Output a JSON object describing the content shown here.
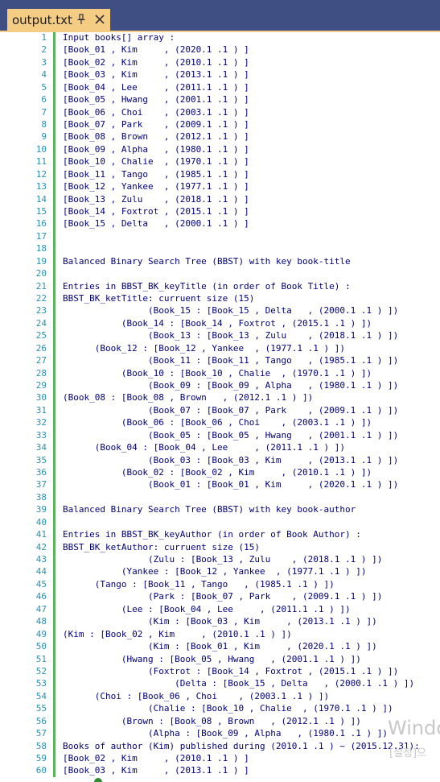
{
  "tab": {
    "title": "output.txt",
    "pin_icon": "pin-icon",
    "close_icon": "close-icon"
  },
  "editor": {
    "lines": [
      {
        "num": "1",
        "text": "Input books[] array :"
      },
      {
        "num": "2",
        "text": "[Book_01 , Kim     , (2020.1 .1 ) ]"
      },
      {
        "num": "3",
        "text": "[Book_02 , Kim     , (2010.1 .1 ) ]"
      },
      {
        "num": "4",
        "text": "[Book_03 , Kim     , (2013.1 .1 ) ]"
      },
      {
        "num": "5",
        "text": "[Book_04 , Lee     , (2011.1 .1 ) ]"
      },
      {
        "num": "6",
        "text": "[Book_05 , Hwang   , (2001.1 .1 ) ]"
      },
      {
        "num": "7",
        "text": "[Book_06 , Choi    , (2003.1 .1 ) ]"
      },
      {
        "num": "8",
        "text": "[Book_07 , Park    , (2009.1 .1 ) ]"
      },
      {
        "num": "9",
        "text": "[Book_08 , Brown   , (2012.1 .1 ) ]"
      },
      {
        "num": "10",
        "text": "[Book_09 , Alpha   , (1980.1 .1 ) ]"
      },
      {
        "num": "11",
        "text": "[Book_10 , Chalie  , (1970.1 .1 ) ]"
      },
      {
        "num": "12",
        "text": "[Book_11 , Tango   , (1985.1 .1 ) ]"
      },
      {
        "num": "13",
        "text": "[Book_12 , Yankee  , (1977.1 .1 ) ]"
      },
      {
        "num": "14",
        "text": "[Book_13 , Zulu    , (2018.1 .1 ) ]"
      },
      {
        "num": "15",
        "text": "[Book_14 , Foxtrot , (2015.1 .1 ) ]"
      },
      {
        "num": "16",
        "text": "[Book_15 , Delta   , (2000.1 .1 ) ]"
      },
      {
        "num": "17",
        "text": ""
      },
      {
        "num": "18",
        "text": ""
      },
      {
        "num": "19",
        "text": "Balanced Binary Search Tree (BBST) with key book-title"
      },
      {
        "num": "20",
        "text": ""
      },
      {
        "num": "21",
        "text": "Entries in BBST_BK_keyTitle (in order of Book Title) :"
      },
      {
        "num": "22",
        "text": "BBST_BK_ketTitle: curruent size (15)"
      },
      {
        "num": "23",
        "text": "                (Book_15 : [Book_15 , Delta   , (2000.1 .1 ) ])"
      },
      {
        "num": "24",
        "text": "           (Book_14 : [Book_14 , Foxtrot , (2015.1 .1 ) ])"
      },
      {
        "num": "25",
        "text": "                (Book_13 : [Book_13 , Zulu    , (2018.1 .1 ) ])"
      },
      {
        "num": "26",
        "text": "      (Book_12 : [Book_12 , Yankee  , (1977.1 .1 ) ])"
      },
      {
        "num": "27",
        "text": "                (Book_11 : [Book_11 , Tango   , (1985.1 .1 ) ])"
      },
      {
        "num": "28",
        "text": "           (Book_10 : [Book_10 , Chalie  , (1970.1 .1 ) ])"
      },
      {
        "num": "29",
        "text": "                (Book_09 : [Book_09 , Alpha   , (1980.1 .1 ) ])"
      },
      {
        "num": "30",
        "text": "(Book_08 : [Book_08 , Brown   , (2012.1 .1 ) ])"
      },
      {
        "num": "31",
        "text": "                (Book_07 : [Book_07 , Park    , (2009.1 .1 ) ])"
      },
      {
        "num": "32",
        "text": "           (Book_06 : [Book_06 , Choi    , (2003.1 .1 ) ])"
      },
      {
        "num": "33",
        "text": "                (Book_05 : [Book_05 , Hwang   , (2001.1 .1 ) ])"
      },
      {
        "num": "34",
        "text": "      (Book_04 : [Book_04 , Lee     , (2011.1 .1 ) ])"
      },
      {
        "num": "35",
        "text": "                (Book_03 : [Book_03 , Kim     , (2013.1 .1 ) ])"
      },
      {
        "num": "36",
        "text": "           (Book_02 : [Book_02 , Kim     , (2010.1 .1 ) ])"
      },
      {
        "num": "37",
        "text": "                (Book_01 : [Book_01 , Kim     , (2020.1 .1 ) ])"
      },
      {
        "num": "38",
        "text": ""
      },
      {
        "num": "39",
        "text": "Balanced Binary Search Tree (BBST) with key book-author"
      },
      {
        "num": "40",
        "text": ""
      },
      {
        "num": "41",
        "text": "Entries in BBST_BK_keyAuthor (in order of Book Author) :"
      },
      {
        "num": "42",
        "text": "BBST_BK_ketAuthor: curruent size (15)"
      },
      {
        "num": "43",
        "text": "                (Zulu : [Book_13 , Zulu    , (2018.1 .1 ) ])"
      },
      {
        "num": "44",
        "text": "           (Yankee : [Book_12 , Yankee  , (1977.1 .1 ) ])"
      },
      {
        "num": "45",
        "text": "      (Tango : [Book_11 , Tango   , (1985.1 .1 ) ])"
      },
      {
        "num": "46",
        "text": "                (Park : [Book_07 , Park    , (2009.1 .1 ) ])"
      },
      {
        "num": "47",
        "text": "           (Lee : [Book_04 , Lee     , (2011.1 .1 ) ])"
      },
      {
        "num": "48",
        "text": "                (Kim : [Book_03 , Kim     , (2013.1 .1 ) ])"
      },
      {
        "num": "49",
        "text": "(Kim : [Book_02 , Kim     , (2010.1 .1 ) ])"
      },
      {
        "num": "50",
        "text": "                (Kim : [Book_01 , Kim     , (2020.1 .1 ) ])"
      },
      {
        "num": "51",
        "text": "           (Hwang : [Book_05 , Hwang   , (2001.1 .1 ) ])"
      },
      {
        "num": "52",
        "text": "                (Foxtrot : [Book_14 , Foxtrot , (2015.1 .1 ) ])"
      },
      {
        "num": "53",
        "text": "                     (Delta : [Book_15 , Delta   , (2000.1 .1 ) ])"
      },
      {
        "num": "54",
        "text": "      (Choi : [Book_06 , Choi    , (2003.1 .1 ) ])"
      },
      {
        "num": "55",
        "text": "                (Chalie : [Book_10 , Chalie  , (1970.1 .1 ) ])"
      },
      {
        "num": "56",
        "text": "           (Brown : [Book_08 , Brown   , (2012.1 .1 ) ])"
      },
      {
        "num": "57",
        "text": "                (Alpha : [Book_09 , Alpha   , (1980.1 .1 ) ])"
      },
      {
        "num": "58",
        "text": "Books of author (Kim) published during (2010.1 .1 ) ~ (2015.12.31):"
      },
      {
        "num": "59",
        "text": "[Book_02 , Kim     , (2010.1 .1 ) ]"
      },
      {
        "num": "60",
        "text": "[Book_03 , Kim     , (2013.1 .1 ) ]"
      }
    ]
  },
  "watermark": {
    "title": "Windo",
    "subtitle": "[설정]으"
  },
  "colors": {
    "tab_background": "#f5cc84",
    "title_bar": "#3f4f83",
    "line_number": "#2b91af",
    "code_text": "#00007a",
    "change_track": "#5db35d"
  }
}
